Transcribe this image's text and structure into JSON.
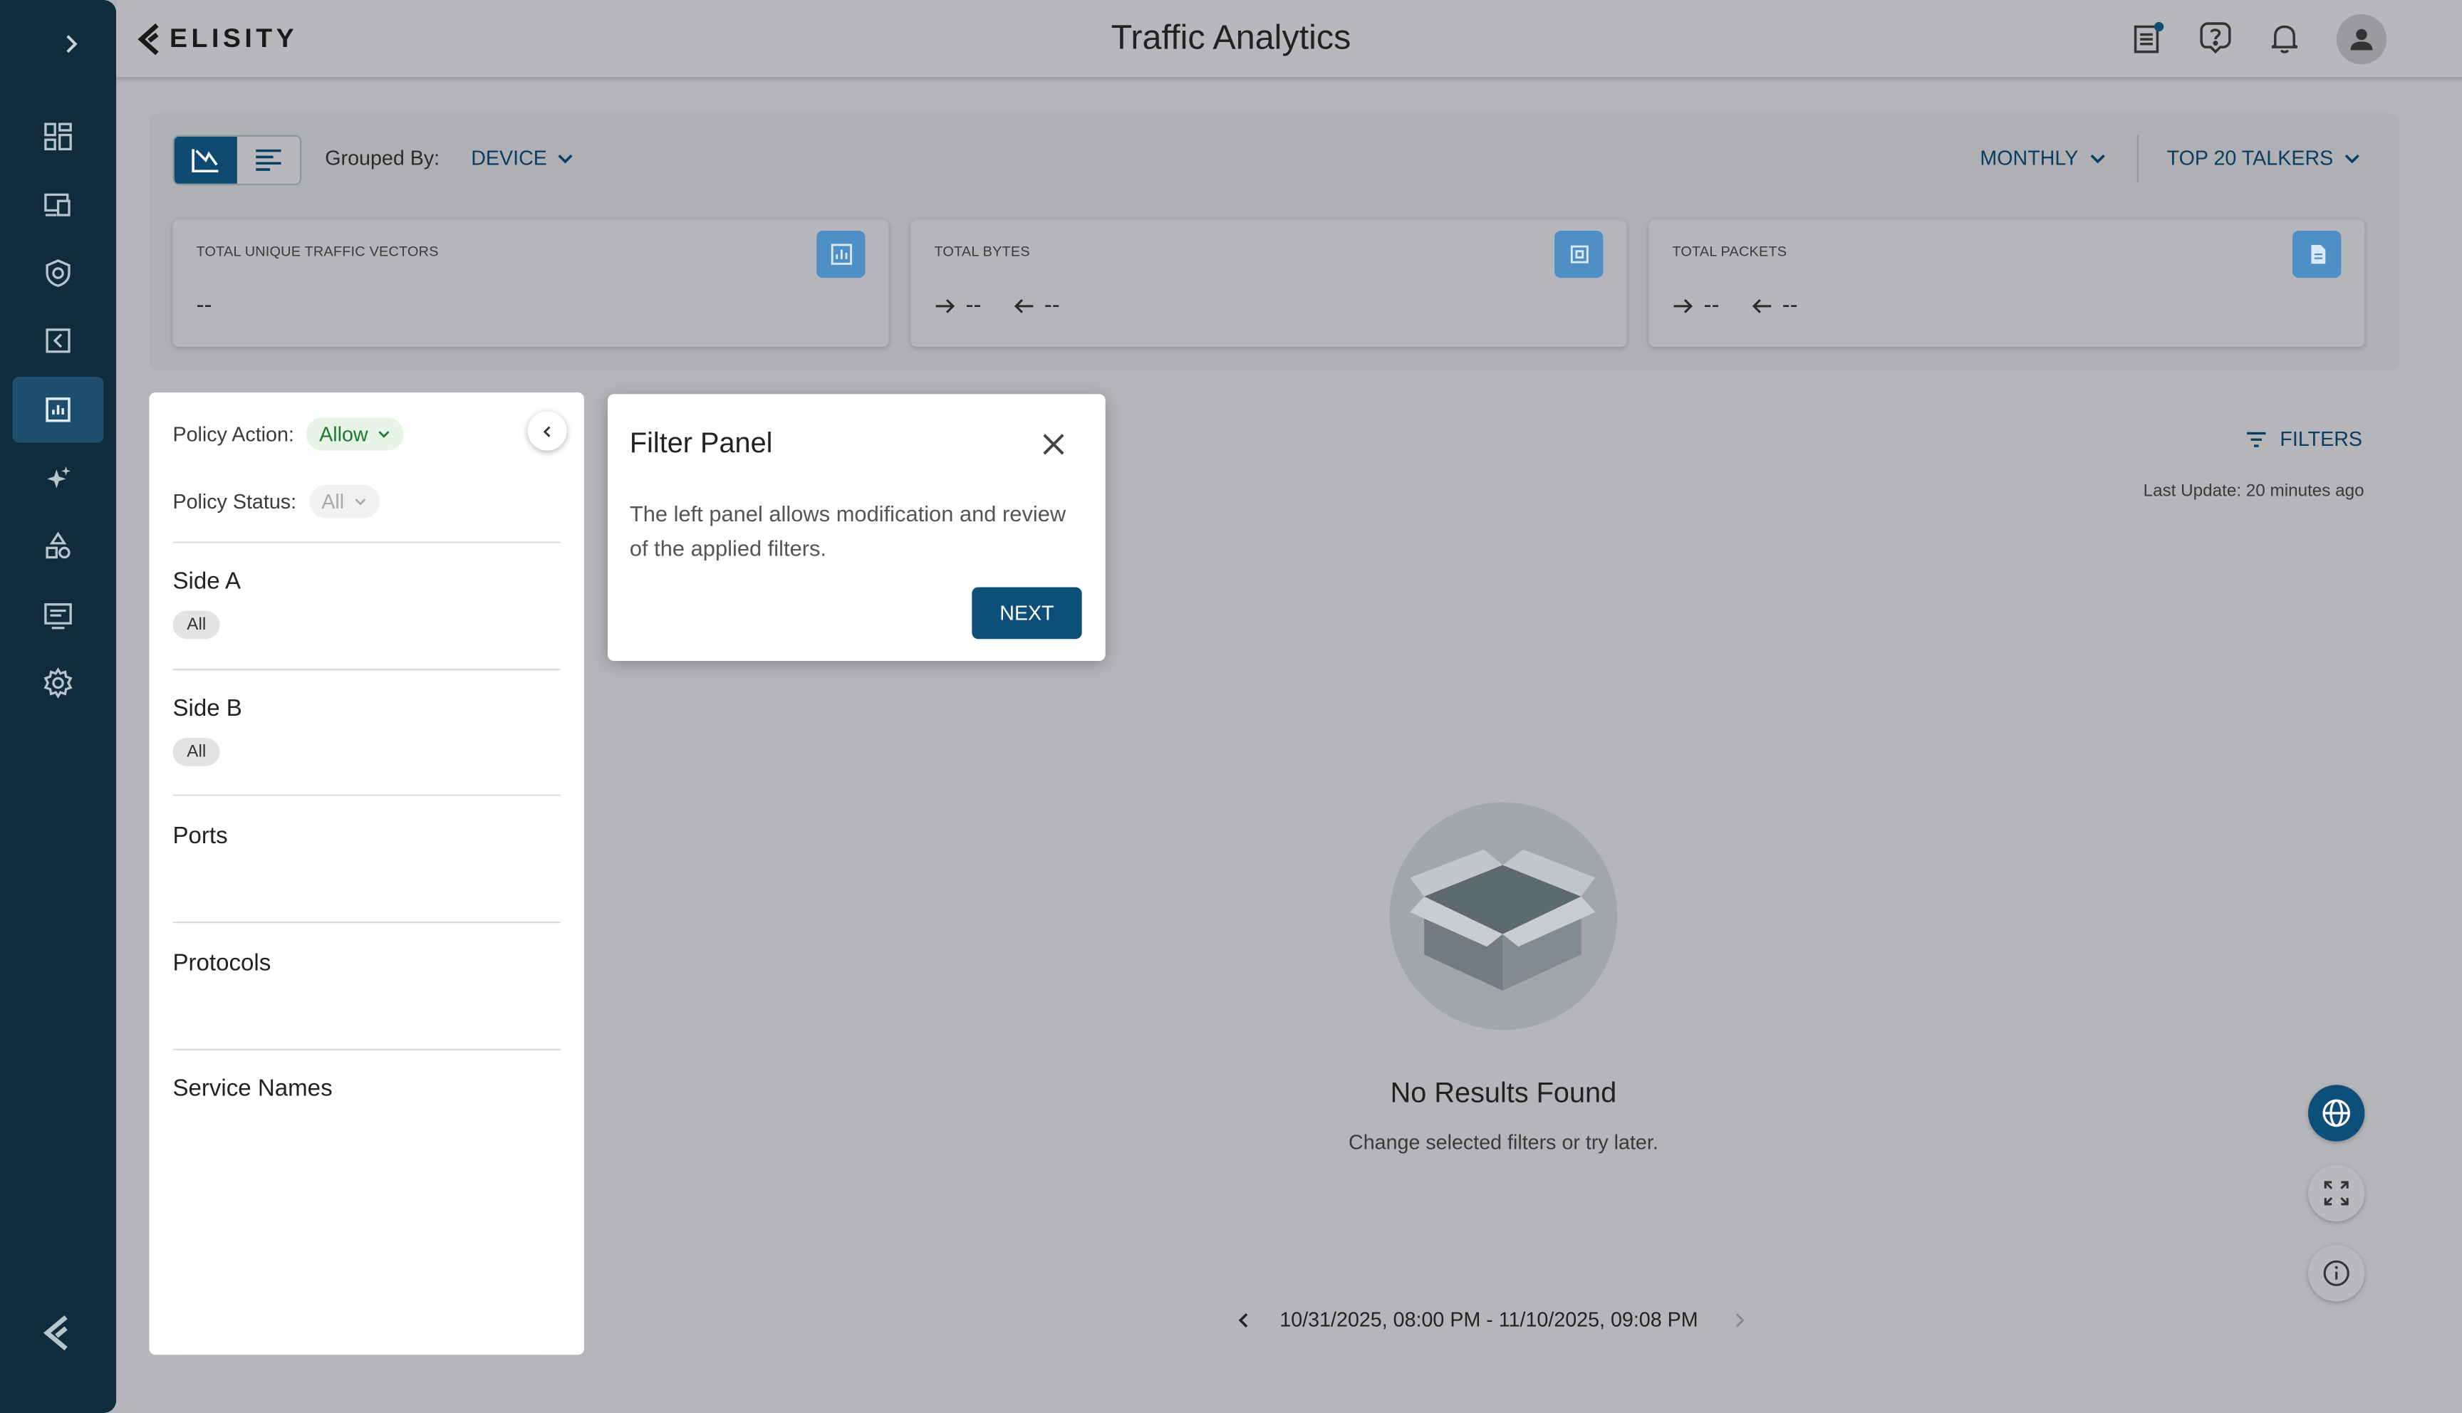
{
  "app": {
    "brand": "ELISITY",
    "title": "Traffic Analytics"
  },
  "toolbar": {
    "grouped_by_label": "Grouped By:",
    "grouped_by_value": "DEVICE",
    "period": "MONTHLY",
    "talkers": "TOP 20 TALKERS"
  },
  "cards": [
    {
      "label": "TOTAL UNIQUE TRAFFIC VECTORS",
      "value": "--"
    },
    {
      "label": "TOTAL BYTES",
      "out": "--",
      "in": "--"
    },
    {
      "label": "TOTAL PACKETS",
      "out": "--",
      "in": "--"
    }
  ],
  "filter_panel": {
    "policy_action_label": "Policy Action:",
    "policy_action_value": "Allow",
    "policy_status_label": "Policy Status:",
    "policy_status_value": "All",
    "side_a": {
      "heading": "Side A",
      "chip": "All"
    },
    "side_b": {
      "heading": "Side B",
      "chip": "All"
    },
    "ports": "Ports",
    "protocols": "Protocols",
    "service_names": "Service Names"
  },
  "results": {
    "filters_label": "FILTERS",
    "last_update": "Last Update: 20 minutes ago",
    "empty_title": "No Results Found",
    "empty_sub": "Change selected filters or try later.",
    "date_range": "10/31/2025, 08:00 PM - 11/10/2025, 09:08 PM"
  },
  "popover": {
    "title": "Filter Panel",
    "body": "The left panel allows modification and review of the applied filters.",
    "next": "NEXT"
  },
  "colors": {
    "sidebar": "#102c3c",
    "primary": "#0e4f7a",
    "allow_green": "#1f7a2b"
  }
}
